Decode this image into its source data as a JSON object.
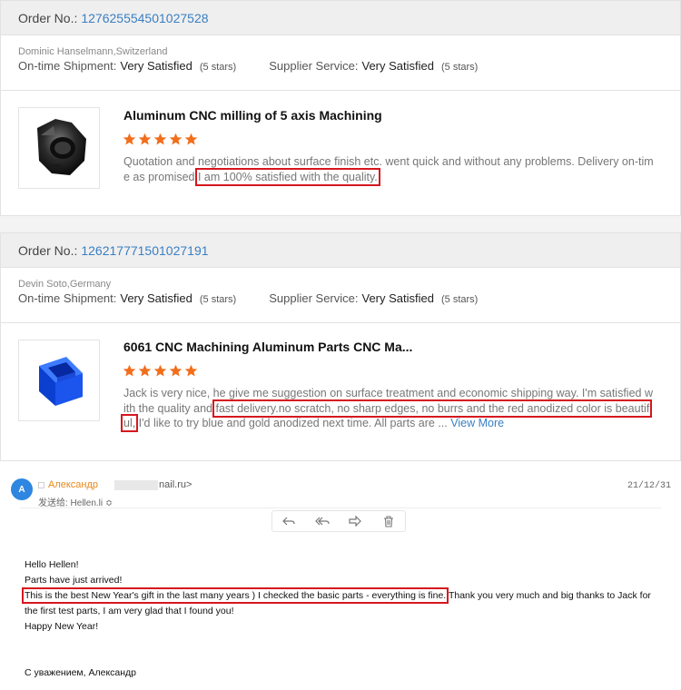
{
  "reviews": [
    {
      "order_label": "Order No.:",
      "order_number": "127625554501027528",
      "buyer": "Dominic Hanselmann,Switzerland",
      "shipment_label": "On-time Shipment:",
      "shipment_value": "Very Satisfied",
      "shipment_stars": "(5 stars)",
      "supplier_label": "Supplier Service:",
      "supplier_value": "Very Satisfied",
      "supplier_stars": "(5 stars)",
      "product_title": "Aluminum CNC milling of 5 axis Machining",
      "rating": 5,
      "text_before": "Quotation and negotiations about surface finish etc. went quick and without any problems. Delivery on-time as promised.",
      "text_highlight": "I am 100% satisfied with the quality.",
      "text_after": "",
      "view_more": ""
    },
    {
      "order_label": "Order No.:",
      "order_number": "126217771501027191",
      "buyer": "Devin Soto,Germany",
      "shipment_label": "On-time Shipment:",
      "shipment_value": "Very Satisfied",
      "shipment_stars": "(5 stars)",
      "supplier_label": "Supplier Service:",
      "supplier_value": "Very Satisfied",
      "supplier_stars": "(5 stars)",
      "product_title": "6061 CNC Machining Aluminum Parts CNC Ma...",
      "rating": 5,
      "text_before": "Jack is very nice, he give me suggestion on surface treatment and economic shipping way. I'm satisfied with the quality and ",
      "text_highlight": "fast delivery.no scratch, no sharp edges, no burrs and the red anodized color is beautiful,",
      "text_after": " I'd like to try blue and gold anodized next time. All parts are ... ",
      "view_more": "View More"
    }
  ],
  "email": {
    "avatar_letter": "A",
    "sender_name": "Александр",
    "sender_email_visible": "nail.ru>",
    "recipient": "发送给: Hellen.li ≎",
    "date": "21/12/31",
    "toolbar_icons": [
      "reply-icon",
      "reply-all-icon",
      "forward-icon",
      "trash-icon"
    ],
    "greeting": "Hello Hellen!",
    "line2": "Parts have just arrived!",
    "highlight": "This is the best New Year's gift in the last many years ) I checked the basic parts - everything is fine.",
    "line3_rest": " Thank you very much and big thanks to Jack for the first test parts, I am very glad that I found you!",
    "line4": "Happy New Year!",
    "signature": "С уважением, Александр"
  },
  "colors": {
    "star": "#f26e1b",
    "link": "#3a7fc2",
    "highlight_box": "#d6171e",
    "sender_name": "#e9891b",
    "avatar": "#2e86e0"
  }
}
